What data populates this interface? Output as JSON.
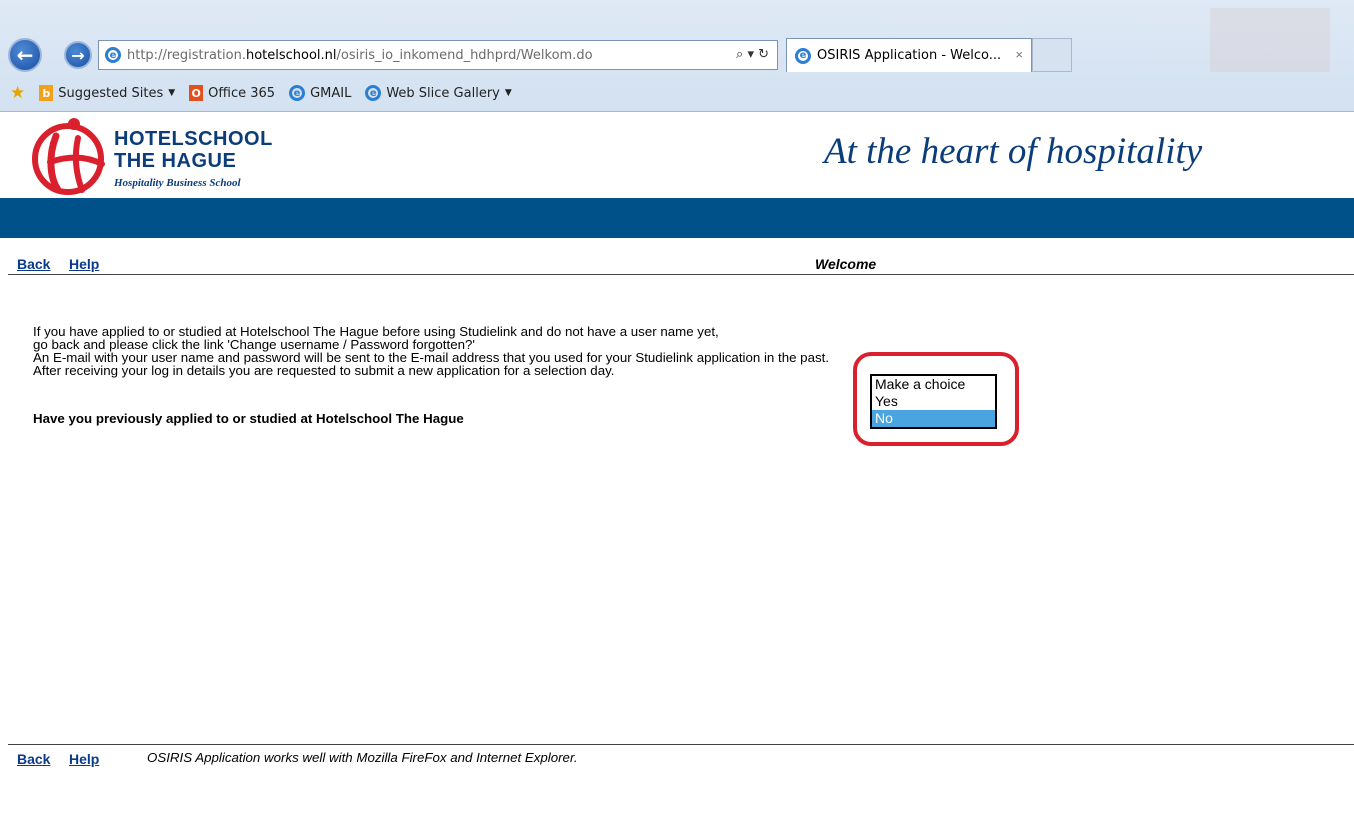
{
  "browser": {
    "url_prefix": "http://registration.",
    "url_domain": "hotelschool.nl",
    "url_path": "/osiris_io_inkomend_hdhprd/Welkom.do",
    "address_tools": "⌕ ▾ ↻",
    "tab_title": "OSIRIS Application - Welco...",
    "tab_close": "×",
    "favorites": [
      {
        "label": "Suggested Sites",
        "has_dropdown": true
      },
      {
        "label": "Office 365",
        "has_dropdown": false
      },
      {
        "label": "GMAIL",
        "has_dropdown": false
      },
      {
        "label": "Web Slice Gallery",
        "has_dropdown": true
      }
    ]
  },
  "header": {
    "logo_line1": "HOTELSCHOOL",
    "logo_line2": "THE HAGUE",
    "logo_line3": "Hospitality Business School",
    "tagline": "At the heart of hospitality",
    "brand_color": "#00508a",
    "logo_red": "#d9202c"
  },
  "nav": {
    "back": "Back",
    "help": "Help",
    "page_title": "Welcome"
  },
  "content": {
    "lines": [
      "If you have applied to or studied at Hotelschool The Hague before using Studielink and do not have a user name yet,",
      "go back and please click the link 'Change username / Password forgotten?'",
      "An E-mail with your user name and password will be sent to the E-mail address that you used for your Studielink application in the past.",
      "After receiving your log in details you are requested to submit a new application for a selection day."
    ],
    "question": "Have you previously applied to or studied at Hotelschool The Hague",
    "options": [
      "Make a choice",
      "Yes",
      "No"
    ],
    "selected_option": "No",
    "highlight_color": "#d9202c"
  },
  "footer": {
    "back": "Back",
    "help": "Help",
    "note": "OSIRIS Application works well with Mozilla FireFox and Internet Explorer."
  }
}
